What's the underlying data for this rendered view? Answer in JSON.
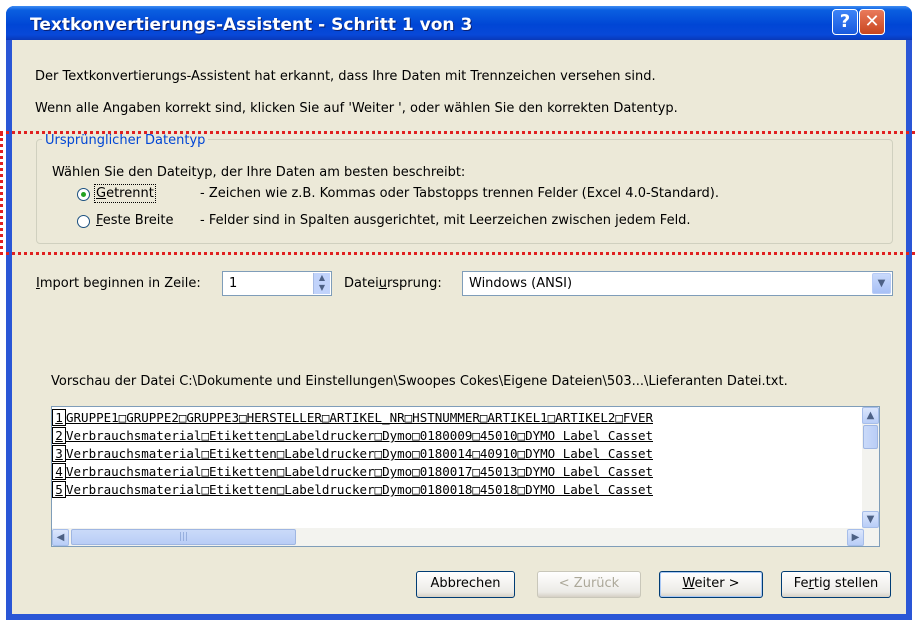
{
  "window": {
    "title": "Textkonvertierungs-Assistent - Schritt 1 von 3",
    "help_label": "?",
    "close_label": "✕"
  },
  "intro": {
    "line1": "Der Textkonvertierungs-Assistent hat erkannt, dass Ihre Daten mit Trennzeichen versehen sind.",
    "line2": "Wenn alle Angaben korrekt sind, klicken Sie auf 'Weiter ', oder wählen Sie den korrekten Datentyp."
  },
  "datatype_group": {
    "label": "Ursprünglicher Datentyp",
    "prompt": "Wählen Sie den Dateityp, der Ihre Daten am besten beschreibt:",
    "options": [
      {
        "label": "Getrennt",
        "description": "- Zeichen wie z.B. Kommas oder Tabstopps trennen Felder (Excel 4.0-Standard).",
        "selected": true
      },
      {
        "label": "Feste Breite",
        "description": "- Felder sind in Spalten ausgerichtet, mit Leerzeichen zwischen jedem Feld.",
        "selected": false
      }
    ]
  },
  "import": {
    "start_row_label": "Import beginnen in Zeile:",
    "start_row_value": "1",
    "origin_label": "Dateiursprung:",
    "origin_value": "Windows (ANSI)"
  },
  "preview": {
    "label": "Vorschau der Datei C:\\Dokumente und Einstellungen\\Swoopes Cokes\\Eigene Dateien\\503...\\Lieferanten Datei.txt.",
    "rows": [
      {
        "num": "1",
        "text": "GRUPPE1□GRUPPE2□GRUPPE3□HERSTELLER□ARTIKEL_NR□HSTNUMMER□ARTIKEL1□ARTIKEL2□FVER"
      },
      {
        "num": "2",
        "text": "Verbrauchsmaterial□Etiketten□Labeldrucker□Dymo□0180009□45010□DYMO Label Casset"
      },
      {
        "num": "3",
        "text": "Verbrauchsmaterial□Etiketten□Labeldrucker□Dymo□0180014□40910□DYMO Label Casset"
      },
      {
        "num": "4",
        "text": "Verbrauchsmaterial□Etiketten□Labeldrucker□Dymo□0180017□45013□DYMO Label Casset"
      },
      {
        "num": "5",
        "text": "Verbrauchsmaterial□Etiketten□Labeldrucker□Dymo□0180018□45018□DYMO Label Casset"
      }
    ]
  },
  "buttons": {
    "cancel": "Abbrechen",
    "back": "< Zurück",
    "next": "Weiter >",
    "finish": "Fertig stellen"
  },
  "colors": {
    "title_bar": "#0046d5",
    "dialog_background": "#ece9d8",
    "group_label": "#0046d5",
    "annotation_dotted": "#e02020"
  }
}
